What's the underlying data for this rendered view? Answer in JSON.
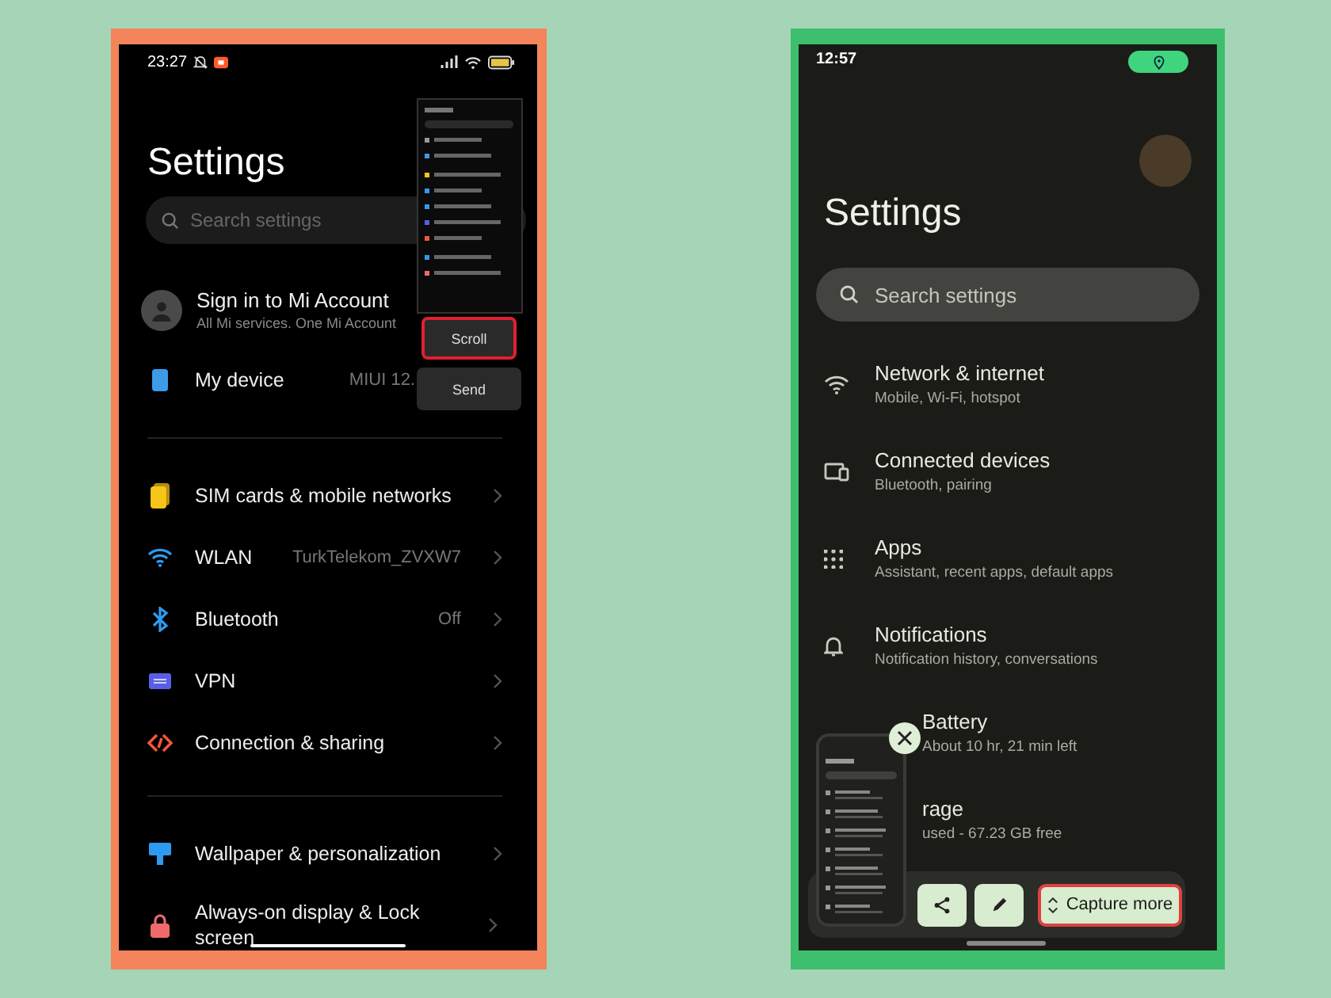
{
  "left_phone": {
    "status_bar": {
      "time": "23:27"
    },
    "title": "Settings",
    "search": {
      "placeholder": "Search settings"
    },
    "account": {
      "title": "Sign in to Mi Account",
      "subtitle": "All Mi services. One Mi Account"
    },
    "groups": [
      {
        "items": [
          {
            "kind": "device",
            "label": "My device",
            "value": "MIUI 12."
          }
        ]
      },
      {
        "items": [
          {
            "kind": "sim",
            "label": "SIM cards & mobile networks"
          },
          {
            "kind": "wifi",
            "label": "WLAN",
            "value": "TurkTelekom_ZVXW7"
          },
          {
            "kind": "bluetooth",
            "label": "Bluetooth",
            "value": "Off"
          },
          {
            "kind": "vpn",
            "label": "VPN"
          },
          {
            "kind": "connection",
            "label": "Connection & sharing"
          }
        ]
      },
      {
        "items": [
          {
            "kind": "wallpaper",
            "label": "Wallpaper & personalization"
          },
          {
            "kind": "lock",
            "label": "Always-on display & Lock screen"
          }
        ]
      }
    ],
    "screenshot_menu": [
      {
        "label": "Scroll",
        "highlighted": true
      },
      {
        "label": "Send",
        "highlighted": false
      }
    ]
  },
  "right_phone": {
    "status_bar": {
      "time": "12:57"
    },
    "title": "Settings",
    "search": {
      "placeholder": "Search settings"
    },
    "items": [
      {
        "kind": "wifi",
        "title": "Network & internet",
        "subtitle": "Mobile, Wi-Fi, hotspot",
        "clipped": false
      },
      {
        "kind": "devices",
        "title": "Connected devices",
        "subtitle": "Bluetooth, pairing",
        "clipped": false
      },
      {
        "kind": "apps",
        "title": "Apps",
        "subtitle": "Assistant, recent apps, default apps",
        "clipped": false
      },
      {
        "kind": "bell",
        "title": "Notifications",
        "subtitle": "Notification history, conversations",
        "clipped": false
      },
      {
        "title": "Battery",
        "subtitle": "About 10 hr, 21 min left",
        "clipped": true
      },
      {
        "title": "rage",
        "subtitle": "used - 67.23 GB free",
        "clipped": true
      }
    ],
    "capture_toolbar": {
      "capture_label": "Capture more",
      "highlighted": true
    }
  }
}
